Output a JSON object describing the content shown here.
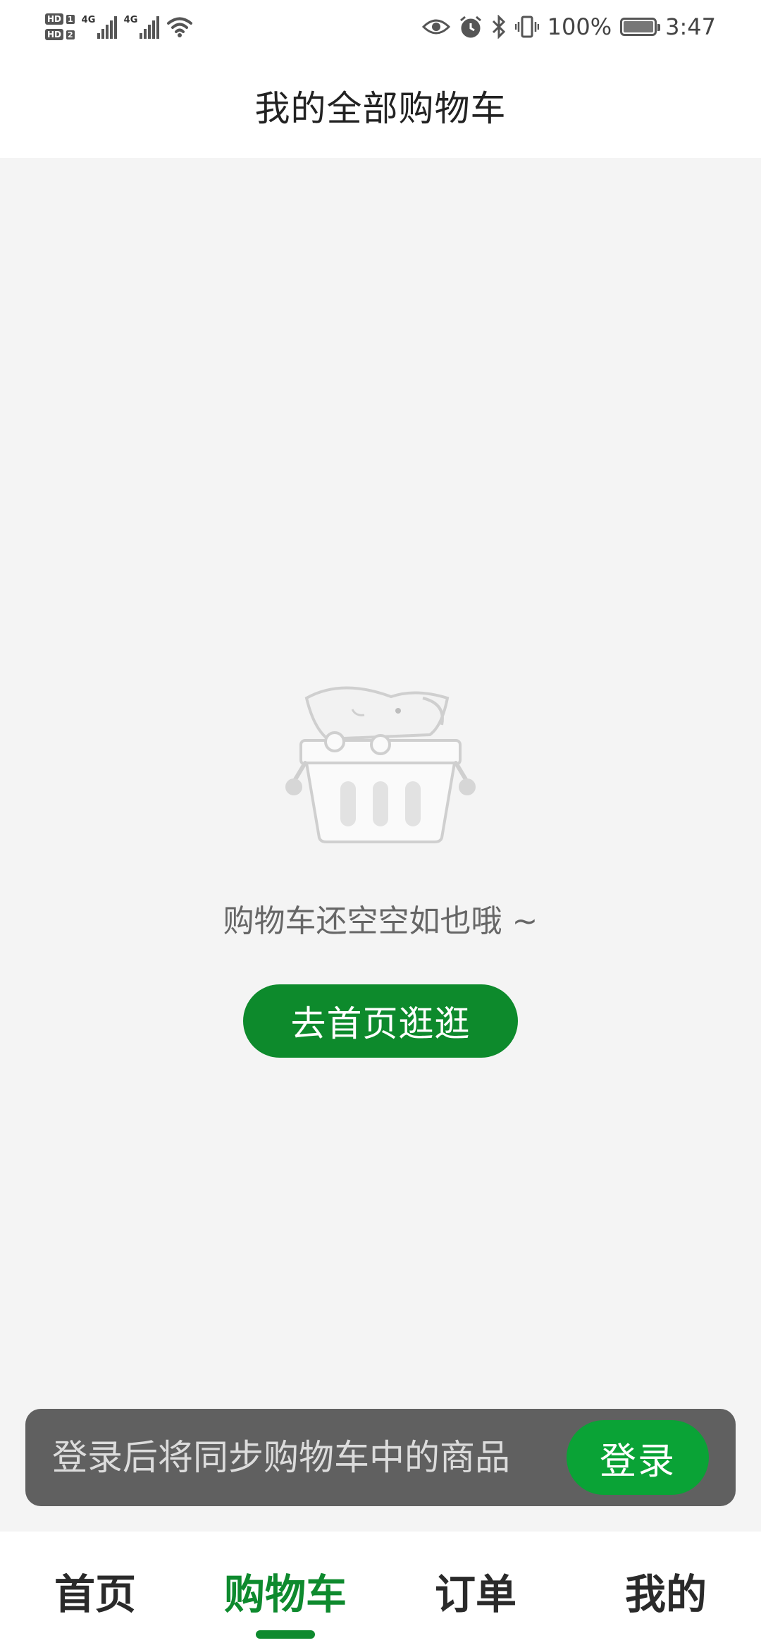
{
  "status_bar": {
    "hd1": "HD",
    "sim1": "1",
    "hd2": "HD",
    "sim2": "2",
    "network1": "4G",
    "network2": "4G",
    "battery_percent": "100%",
    "time": "3:47"
  },
  "header": {
    "title": "我的全部购物车"
  },
  "empty_state": {
    "illustration_icon": "empty-basket-illustration",
    "message": "购物车还空空如也哦 ~",
    "go_home_label": "去首页逛逛"
  },
  "login_banner": {
    "hint": "登录后将同步购物车中的商品",
    "login_label": "登录"
  },
  "bottom_nav": {
    "items": [
      {
        "label": "首页"
      },
      {
        "label": "购物车"
      },
      {
        "label": "订单"
      },
      {
        "label": "我的"
      }
    ],
    "active_index": 1
  },
  "colors": {
    "accent": "#0e8a2e",
    "login_button": "#0aa336",
    "banner_bg": "#606060",
    "page_bg": "#f4f4f4"
  }
}
